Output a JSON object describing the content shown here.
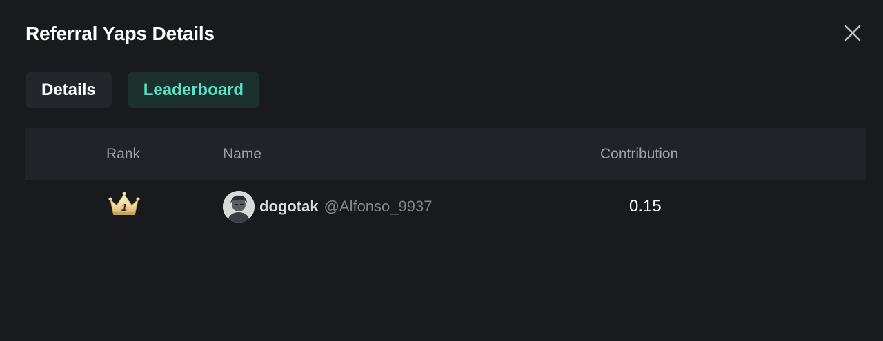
{
  "modal": {
    "title": "Referral Yaps Details",
    "close_icon": "close-icon"
  },
  "tabs": [
    {
      "label": "Details",
      "active": false
    },
    {
      "label": "Leaderboard",
      "active": true
    }
  ],
  "colors": {
    "background": "#181a1e",
    "accent": "#4fe5c6",
    "header_bg": "#202327"
  },
  "leaderboard": {
    "columns": [
      "Rank",
      "Name",
      "Contribution"
    ],
    "rows": [
      {
        "rank": 1,
        "rank_icon": "crown-icon",
        "rank_label": "1",
        "username": "dogotak",
        "handle": "@Alfonso_9937",
        "contribution": "0.15"
      }
    ]
  }
}
